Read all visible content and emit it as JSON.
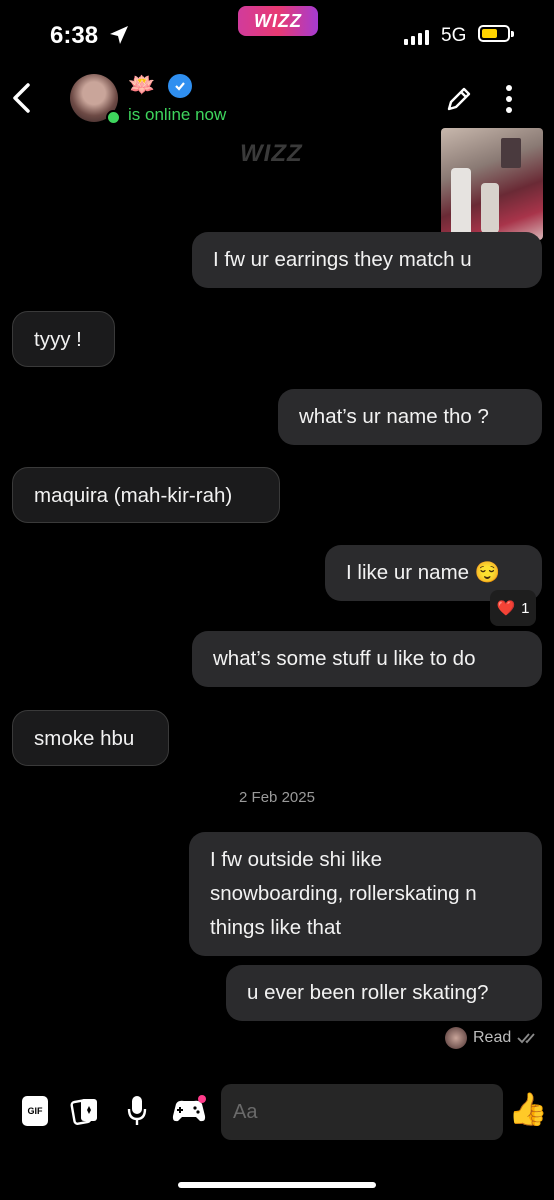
{
  "status_bar": {
    "time": "6:38",
    "network": "5G",
    "brand": "WIZZ"
  },
  "header": {
    "emoji": "🪷",
    "status": "is online now"
  },
  "watermark": "WIZZ",
  "messages": [
    {
      "dir": "out",
      "text": "I fw ur earrings they match u"
    },
    {
      "dir": "in",
      "text": "tyyy !"
    },
    {
      "dir": "out",
      "text": "what’s ur name tho ?"
    },
    {
      "dir": "in",
      "text": "maquira (mah-kir-rah)"
    },
    {
      "dir": "out",
      "text": "I like ur name 😌"
    },
    {
      "dir": "out",
      "text": "what’s some stuff u like to do"
    },
    {
      "dir": "in",
      "text": "smoke hbu"
    },
    {
      "dir": "out",
      "text": "I fw outside shi like snowboarding, rollerskating n things like that"
    },
    {
      "dir": "out",
      "text": "u ever been roller skating?"
    }
  ],
  "reaction": {
    "emoji": "❤️",
    "count": "1"
  },
  "date_divider": "2 Feb 2025",
  "read_receipt": "Read",
  "composer": {
    "gif_label": "GIF",
    "placeholder": "Aa",
    "like_emoji": "👍"
  }
}
